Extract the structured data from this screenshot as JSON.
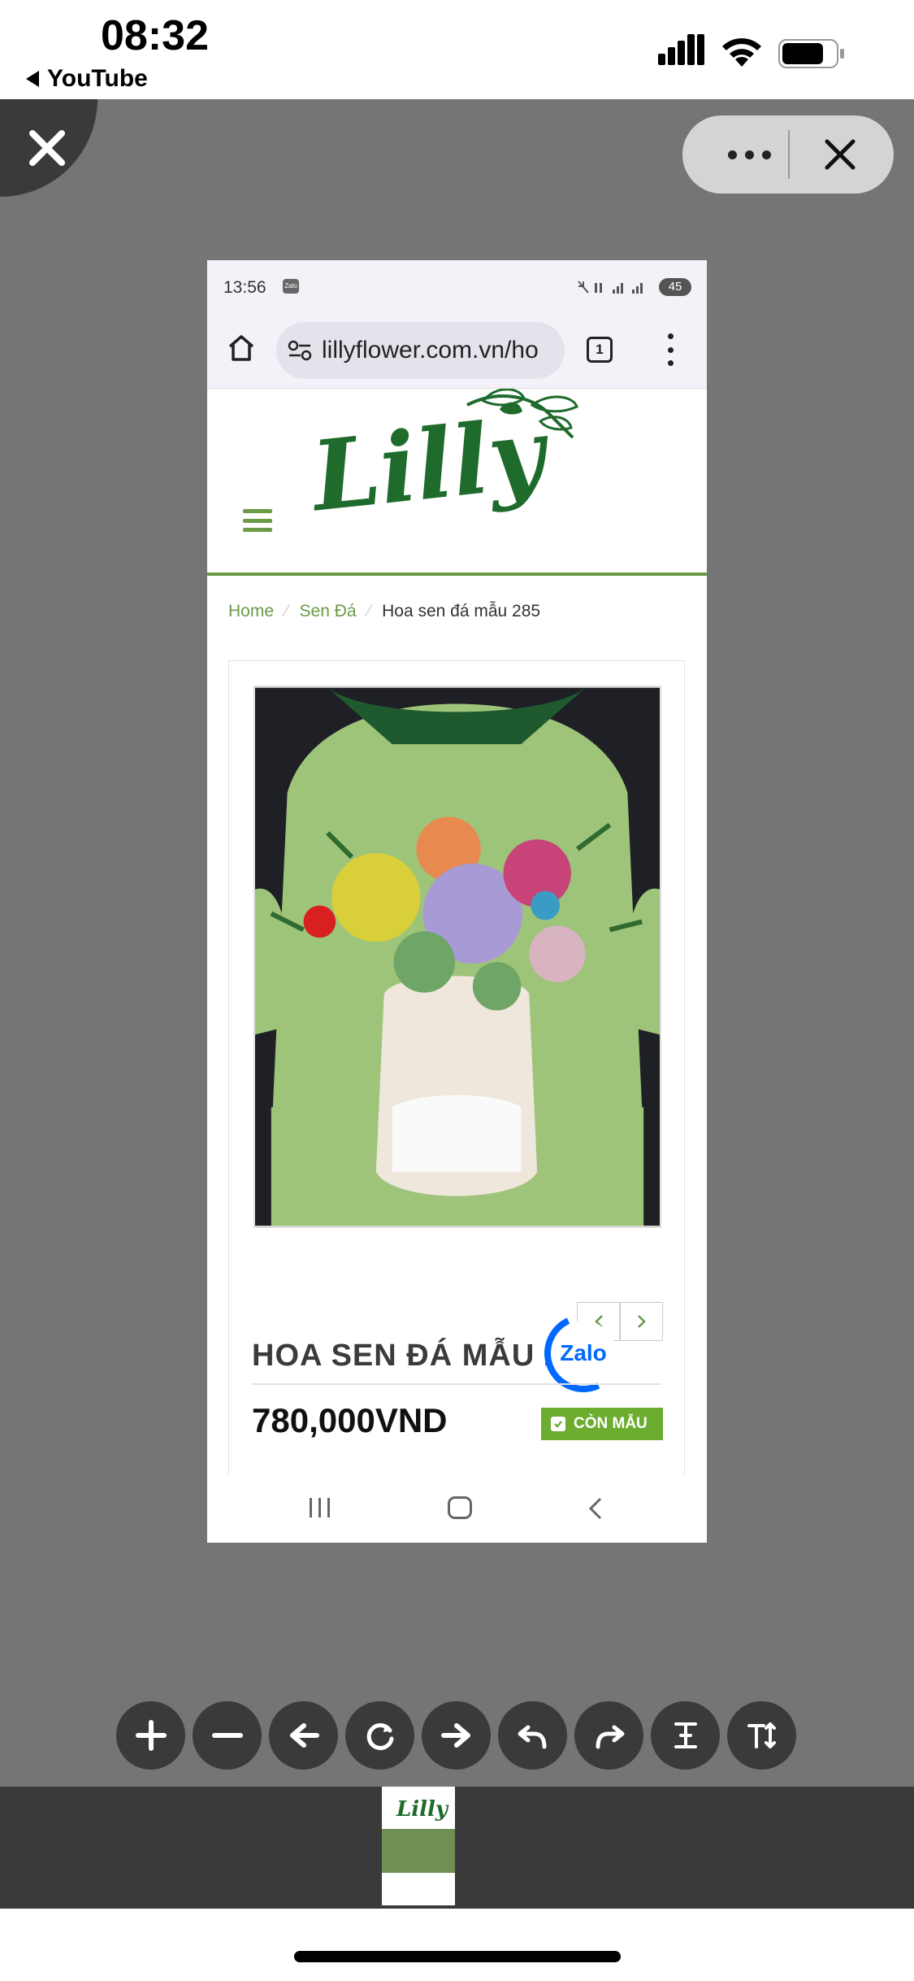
{
  "ios_status": {
    "time": "08:32",
    "back_app": "YouTube"
  },
  "viewer": {
    "close_icon": "close-icon",
    "more_icon": "more-dots-icon",
    "dismiss_icon": "x-icon"
  },
  "phone": {
    "status_time": "13:56",
    "zalo_notification": "Zalo",
    "battery": "45",
    "url": "lillyflower.com.vn/ho",
    "tab_count": "1"
  },
  "site": {
    "logo_text": "Lilly",
    "breadcrumb": [
      "Home",
      "Sen Đá",
      "Hoa sen đá mẫu 285"
    ],
    "product_title": "HOA SEN ĐÁ MẪU 2",
    "price": "780,000VND",
    "stock_label": "CÒN MẪU",
    "zalo_label": "Zalo"
  },
  "toolbar": [
    "zoom-in-icon",
    "zoom-out-icon",
    "arrow-left-icon",
    "rotate-icon",
    "arrow-right-icon",
    "undo-icon",
    "redo-icon",
    "text-fit-icon",
    "text-size-icon"
  ],
  "colors": {
    "brand_green": "#6a9a45",
    "stock_green": "#6cad2f",
    "viewer_bg": "#757575"
  }
}
